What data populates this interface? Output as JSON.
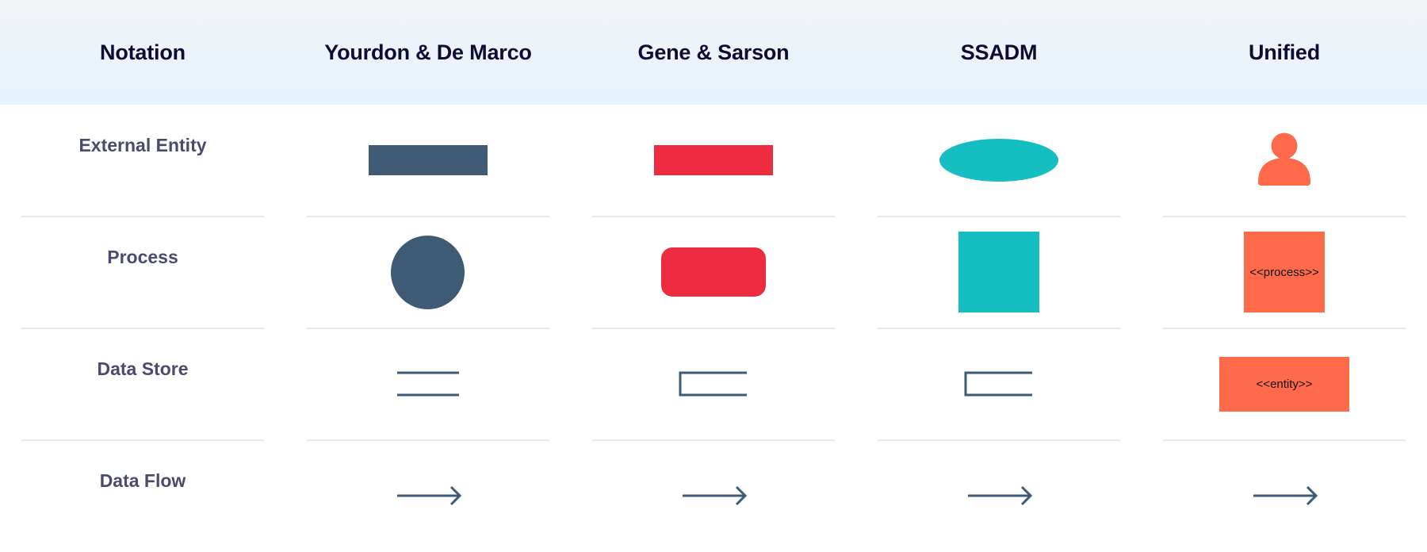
{
  "header": {
    "columns": [
      {
        "label": "Notation"
      },
      {
        "label": "Yourdon & De Marco"
      },
      {
        "label": "Gene & Sarson"
      },
      {
        "label": "SSADM"
      },
      {
        "label": "Unified"
      }
    ]
  },
  "rows": [
    {
      "label": "External Entity"
    },
    {
      "label": "Process"
    },
    {
      "label": "Data Store"
    },
    {
      "label": "Data Flow"
    }
  ],
  "notations": {
    "yourdon": {
      "external_entity": {
        "shape": "rectangle",
        "color": "#3e5a74"
      },
      "process": {
        "shape": "circle",
        "color": "#3e5a74"
      },
      "data_store": {
        "shape": "parallel-lines",
        "color": "#3e5a74"
      },
      "data_flow": {
        "shape": "arrow",
        "color": "#3e5a74"
      }
    },
    "gene_sarson": {
      "external_entity": {
        "shape": "rectangle",
        "color": "#ee2c41"
      },
      "process": {
        "shape": "rounded-rectangle",
        "color": "#ee2c41"
      },
      "data_store": {
        "shape": "open-rectangle",
        "color": "#3e5a74"
      },
      "data_flow": {
        "shape": "arrow",
        "color": "#3e5a74"
      }
    },
    "ssadm": {
      "external_entity": {
        "shape": "ellipse",
        "color": "#15bfc1"
      },
      "process": {
        "shape": "square",
        "color": "#15bfc1"
      },
      "data_store": {
        "shape": "open-rectangle",
        "color": "#3e5a74"
      },
      "data_flow": {
        "shape": "arrow",
        "color": "#3e5a74"
      }
    },
    "unified": {
      "external_entity": {
        "shape": "person-icon",
        "color": "#ff6b4a"
      },
      "process": {
        "shape": "square",
        "color": "#ff6b4a",
        "label": "<<process>>"
      },
      "data_store": {
        "shape": "rectangle",
        "color": "#ff6b4a",
        "label": "<<entity>>"
      },
      "data_flow": {
        "shape": "arrow",
        "color": "#3e5a74"
      }
    }
  },
  "colors": {
    "header_text": "#0d0d33",
    "row_label_text": "#4a4b6d",
    "divider": "#e9e9ec",
    "slate": "#3e5a74",
    "red": "#ee2c41",
    "teal": "#15bfc1",
    "orange": "#ff6b4a"
  }
}
